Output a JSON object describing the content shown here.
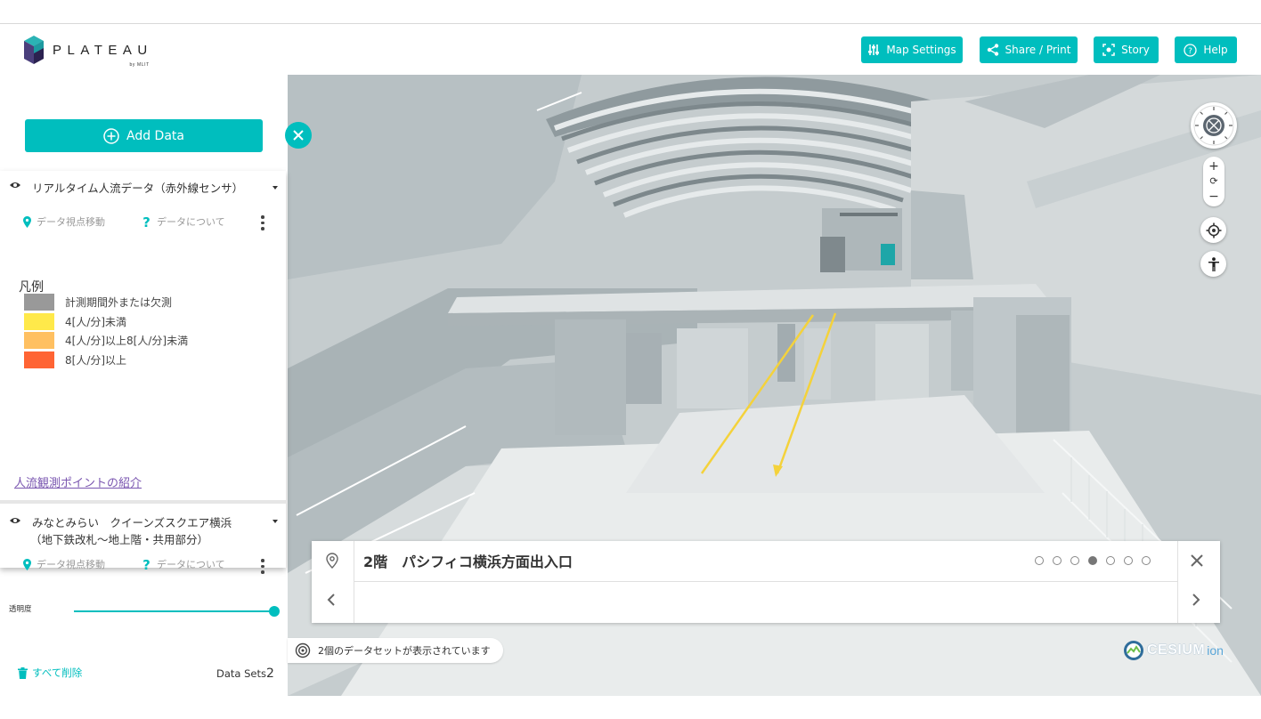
{
  "header": {
    "logo_name": "PLATEAU",
    "logo_sub": "by MLIT",
    "buttons": {
      "map_settings": "Map Settings",
      "share_print": "Share / Print",
      "story": "Story",
      "help": "Help"
    }
  },
  "sidebar": {
    "add_data": "Add Data",
    "datasets": [
      {
        "title": "リアルタイム人流データ（赤外線センサ）",
        "actions": {
          "move": "データ視点移動",
          "about": "データについて"
        }
      },
      {
        "title_line1": "みなとみらい　クイーンズスクエア横浜",
        "title_line2": "（地下鉄改札～地上階・共用部分）",
        "actions": {
          "move": "データ視点移動",
          "about": "データについて"
        },
        "opacity_label": "透明度",
        "opacity_value": 1.0
      }
    ],
    "legend": {
      "title": "凡例",
      "items": [
        {
          "label": "計測期間外または欠測",
          "color": "#999999"
        },
        {
          "label": "4[人/分]未満",
          "color": "#ffe94a"
        },
        {
          "label": "4[人/分]以上8[人/分]未満",
          "color": "#ffc061"
        },
        {
          "label": "8[人/分]以上",
          "color": "#ff6434"
        }
      ]
    },
    "observation_link": "人流観測ポイントの紹介",
    "delete_all": "すべて削除",
    "datasets_label": "Data Sets",
    "datasets_count": "2"
  },
  "story": {
    "title": "2階　パシフィコ横浜方面出入口",
    "page_count": 7,
    "active_page": 4
  },
  "status": {
    "message": "2個のデータセットが表示されています"
  },
  "credits": {
    "cesium": "CESIUM",
    "ion": "ion"
  },
  "colors": {
    "accent": "#00bebe",
    "link": "#7a56b0"
  }
}
